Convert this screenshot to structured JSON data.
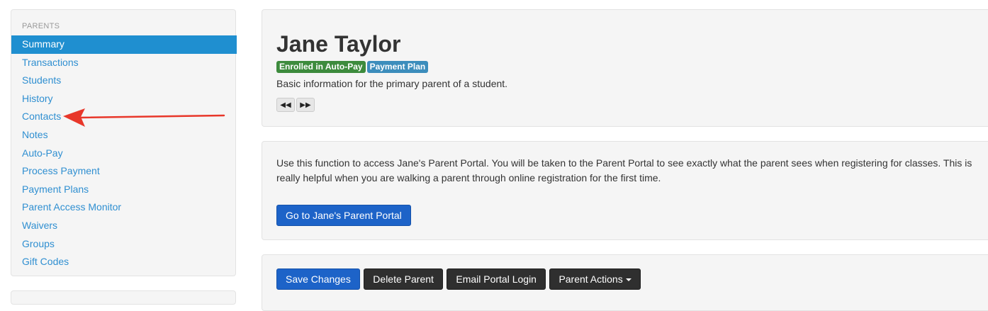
{
  "sidebar": {
    "header": "PARENTS",
    "items": [
      {
        "label": "Summary",
        "active": true
      },
      {
        "label": "Transactions"
      },
      {
        "label": "Students"
      },
      {
        "label": "History"
      },
      {
        "label": "Contacts"
      },
      {
        "label": "Notes"
      },
      {
        "label": "Auto-Pay"
      },
      {
        "label": "Process Payment"
      },
      {
        "label": "Payment Plans"
      },
      {
        "label": "Parent Access Monitor"
      },
      {
        "label": "Waivers"
      },
      {
        "label": "Groups"
      },
      {
        "label": "Gift Codes"
      }
    ]
  },
  "profile": {
    "name": "Jane Taylor",
    "badges": [
      "Enrolled in Auto-Pay",
      "Payment Plan"
    ],
    "subtitle": "Basic information for the primary parent of a student.",
    "prev_icon": "previous-icon",
    "next_icon": "next-icon"
  },
  "portal": {
    "description": "Use this function to access Jane's Parent Portal. You will be taken to the Parent Portal to see exactly what the parent sees when registering for classes. This is really helpful when you are walking a parent through online registration for the first time.",
    "button_label": "Go to Jane's Parent Portal"
  },
  "actions": {
    "save": "Save Changes",
    "delete": "Delete Parent",
    "email": "Email Portal Login",
    "parent_actions": "Parent Actions"
  },
  "colors": {
    "active_nav": "#1f8fd0",
    "link": "#2f8fd1",
    "primary_button": "#1d63c8",
    "dark_button": "#2f2f2f",
    "badge_green": "#3d8b3d",
    "badge_blue": "#3c8dbc",
    "annotation_arrow": "#e8372a"
  }
}
